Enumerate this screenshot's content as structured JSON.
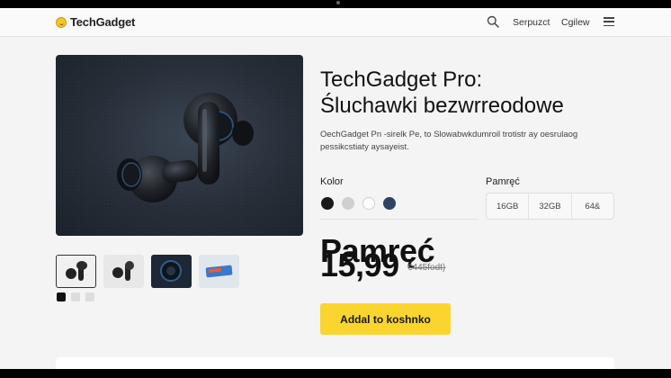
{
  "header": {
    "logo": "TechGadget",
    "nav": [
      "Serpuzct",
      "Cgilew"
    ],
    "icons": [
      "search-icon",
      "menu-icon"
    ]
  },
  "product": {
    "title_line1": "TechGadget Pro:",
    "title_line2": "Śluchawki bezwrreodowe",
    "description": "OechGadget Pn -sirelk Pe, to Slowabwkdumroil trotistr ay oesrulaog pessikcstiaty aysayeist.",
    "color_label": "Kolor",
    "colors": [
      "#1a1a1a",
      "#cfcfcf",
      "#ffffff",
      "#2d4563"
    ],
    "memory_label": "Pamręć",
    "memory_options": [
      "16GB",
      "32GB",
      "64&"
    ],
    "price_label": "Pamręć",
    "price": "15,99",
    "old_price": "€445fodt)",
    "cart_button": "Addal to koshnko"
  },
  "gallery": {
    "thumbnails": [
      "earbuds-front",
      "earbuds-pair",
      "earbud-case-dark",
      "product-box"
    ],
    "mini_icons": [
      "dark-icon",
      "light-icon",
      "light-icon"
    ]
  }
}
